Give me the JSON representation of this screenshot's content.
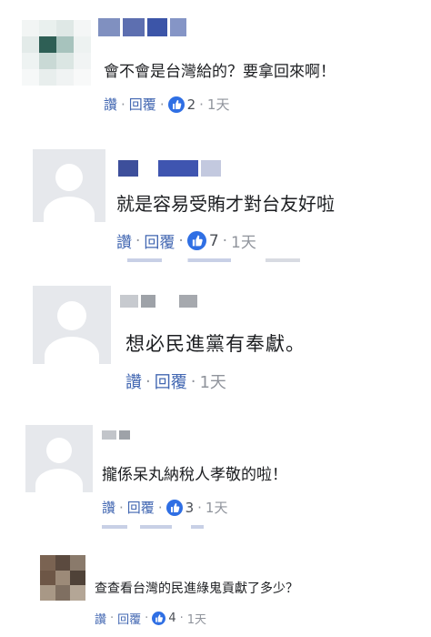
{
  "comments": [
    {
      "text": "會不會是台灣給的？要拿回來啊！",
      "actions": {
        "like": "讚",
        "reply": "回覆",
        "reactions": "2",
        "time": "1天"
      },
      "like_icon": "thumbs-up-icon"
    },
    {
      "text": "就是容易受賄才對台友好啦",
      "actions": {
        "like": "讚",
        "reply": "回覆",
        "reactions": "7",
        "time": "1天"
      },
      "like_icon": "thumbs-up-icon"
    },
    {
      "text": "想必民進黨有奉獻。",
      "actions": {
        "like": "讚",
        "reply": "回覆",
        "time": "1天"
      }
    },
    {
      "text": "攏係呆丸納稅人孝敬的啦！",
      "actions": {
        "like": "讚",
        "reply": "回覆",
        "reactions": "3",
        "time": "1天"
      },
      "like_icon": "thumbs-up-icon"
    },
    {
      "text": "查查看台灣的民進綠鬼貢獻了多少？",
      "actions": {
        "like": "讚",
        "reply": "回覆",
        "reactions": "4",
        "time": "1天"
      },
      "like_icon": "thumbs-up-icon"
    }
  ],
  "colors": {
    "link": "#4267b2",
    "meta": "#90949c",
    "text": "#1c1e21",
    "like_badge": "#2f6fe4",
    "avatar_bg": "#e6e8ec"
  }
}
